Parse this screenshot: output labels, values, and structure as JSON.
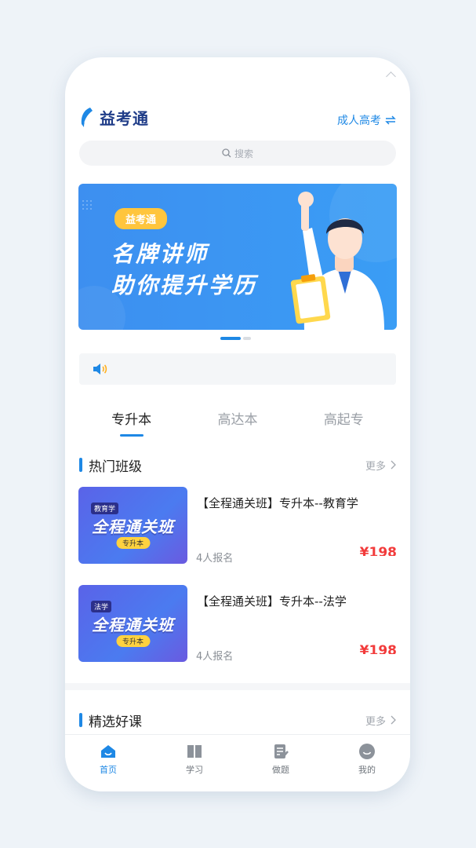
{
  "app": {
    "brand": "益考通",
    "exam_type": "成人高考"
  },
  "search": {
    "placeholder": "搜索"
  },
  "banner": {
    "tag": "益考通",
    "line1": "名牌讲师",
    "line2": "助你提升学历"
  },
  "tabs": [
    {
      "label": "专升本",
      "active": true
    },
    {
      "label": "高达本",
      "active": false
    },
    {
      "label": "高起专",
      "active": false
    }
  ],
  "hot_classes": {
    "title": "热门班级",
    "more": "更多",
    "items": [
      {
        "thumb_tag": "教育学",
        "thumb_title": "全程通关班",
        "thumb_badge": "专升本",
        "title": "【全程通关班】专升本--教育学",
        "enrolled": "4人报名",
        "price": "¥198"
      },
      {
        "thumb_tag": "法学",
        "thumb_title": "全程通关班",
        "thumb_badge": "专升本",
        "title": "【全程通关班】专升本--法学",
        "enrolled": "4人报名",
        "price": "¥198"
      }
    ]
  },
  "featured": {
    "title": "精选好课",
    "more": "更多"
  },
  "tabbar": [
    {
      "label": "首页",
      "icon": "home-icon",
      "active": true
    },
    {
      "label": "学习",
      "icon": "book-icon",
      "active": false
    },
    {
      "label": "做题",
      "icon": "exercise-icon",
      "active": false
    },
    {
      "label": "我的",
      "icon": "profile-icon",
      "active": false
    }
  ],
  "colors": {
    "accent": "#1e88e5",
    "price": "#f23b3b",
    "badge": "#ffc53d"
  }
}
